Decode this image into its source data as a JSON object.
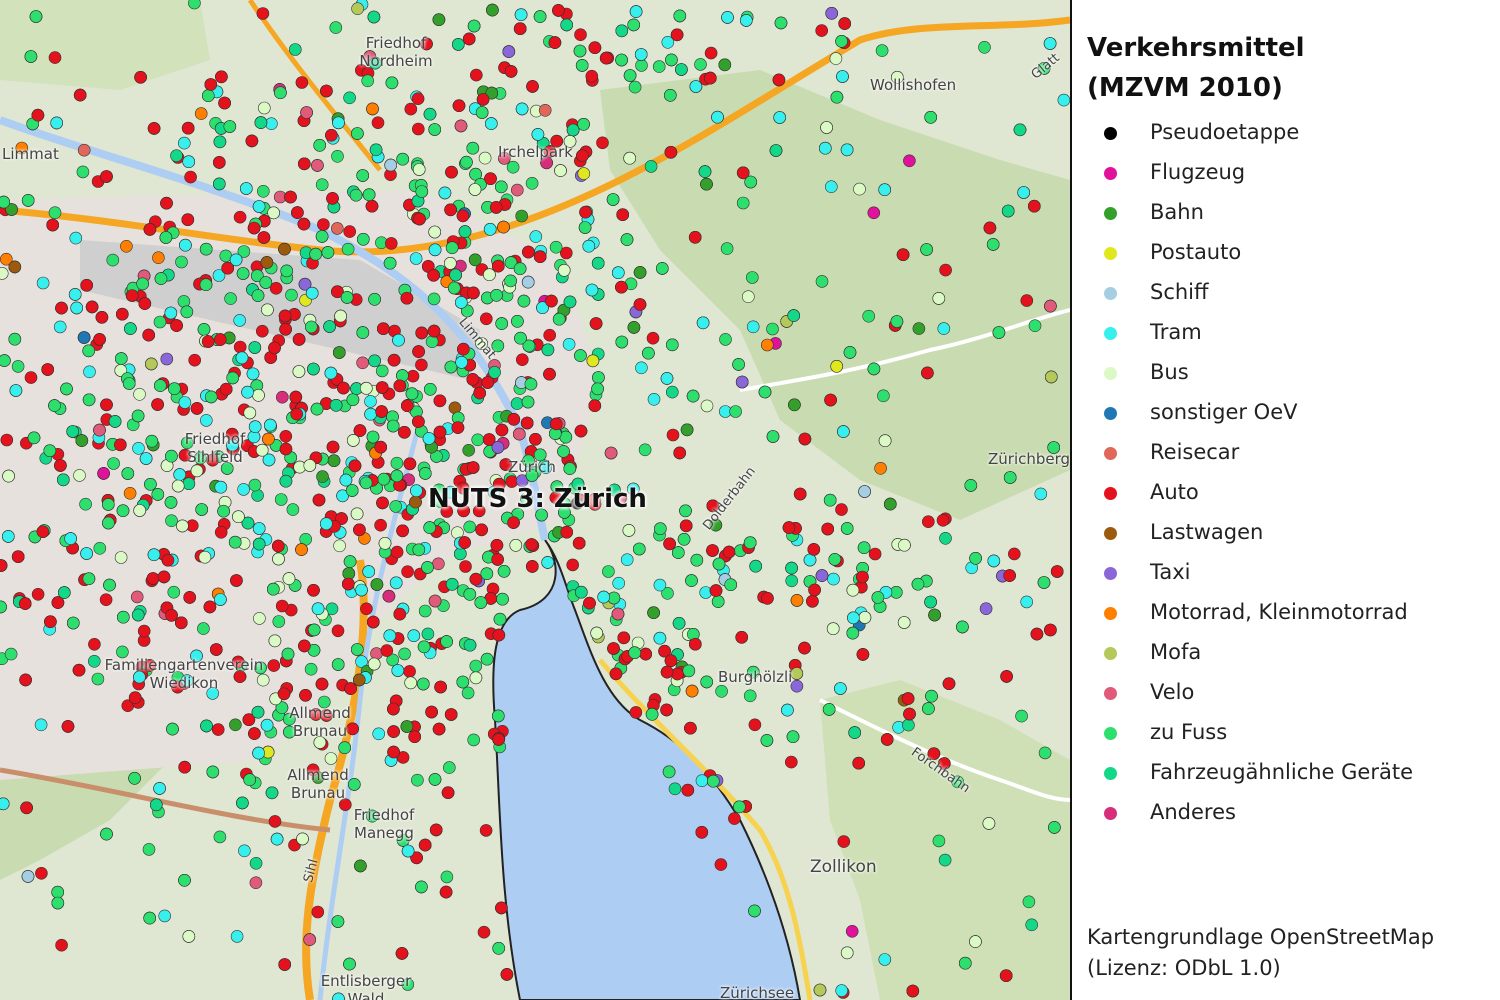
{
  "legend": {
    "title_line1": "Verkehrsmittel",
    "title_line2": "(MZVM 2010)",
    "items": [
      {
        "label": "Pseudoetappe",
        "color": "#000000"
      },
      {
        "label": "Flugzeug",
        "color": "#e0119a"
      },
      {
        "label": "Bahn",
        "color": "#33a02c"
      },
      {
        "label": "Postauto",
        "color": "#dfe81e"
      },
      {
        "label": "Schiff",
        "color": "#a6cee3"
      },
      {
        "label": "Tram",
        "color": "#37f0ee"
      },
      {
        "label": "Bus",
        "color": "#daf9c4"
      },
      {
        "label": "sonstiger OeV",
        "color": "#1f78b4"
      },
      {
        "label": "Reisecar",
        "color": "#e0685a"
      },
      {
        "label": "Auto",
        "color": "#e3121c"
      },
      {
        "label": "Lastwagen",
        "color": "#9c5a0e"
      },
      {
        "label": "Taxi",
        "color": "#8a66d8"
      },
      {
        "label": "Motorrad, Kleinmotorrad",
        "color": "#ff7f00"
      },
      {
        "label": "Mofa",
        "color": "#b4c95a"
      },
      {
        "label": "Velo",
        "color": "#e05a7a"
      },
      {
        "label": "zu Fuss",
        "color": "#2de06e"
      },
      {
        "label": "Fahrzeugähnliche Geräte",
        "color": "#12d888"
      },
      {
        "label": "Anderes",
        "color": "#d62e7a"
      }
    ]
  },
  "credit": {
    "line1": "Kartengrundlage OpenStreetMap",
    "line2": "(Lizenz: ODbL 1.0)"
  },
  "map": {
    "region_label": "NUTS 3: Zürich",
    "place_labels": [
      {
        "name": "Friedhof Nordheim"
      },
      {
        "name": "Limmat"
      },
      {
        "name": "Irchelpark"
      },
      {
        "name": "Wollishofen"
      },
      {
        "name": "Glatt"
      },
      {
        "name": "Friedhof Sihlfeld"
      },
      {
        "name": "Zürich"
      },
      {
        "name": "Zürichberg"
      },
      {
        "name": "Dolderbahn"
      },
      {
        "name": "Familiengartenverein Wiedikon"
      },
      {
        "name": "Burghölzli"
      },
      {
        "name": "Allmend Brunau"
      },
      {
        "name": "Allmend Brunau"
      },
      {
        "name": "Forchbahn"
      },
      {
        "name": "Friedhof Manegg"
      },
      {
        "name": "Sihl"
      },
      {
        "name": "Zollikon"
      },
      {
        "name": "Entlisberger Wald"
      },
      {
        "name": "Zürichsee"
      },
      {
        "name": "Limmat"
      }
    ]
  }
}
